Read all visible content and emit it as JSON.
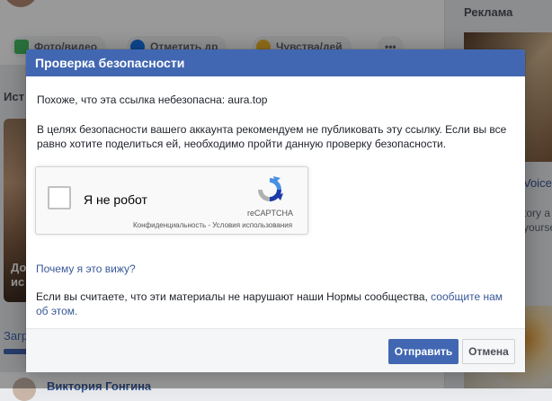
{
  "background": {
    "composer_chips": [
      {
        "label": "Фото/видео",
        "icon": "photo-icon"
      },
      {
        "label": "Отметить др",
        "icon": "tag-friends-icon"
      },
      {
        "label": "Чувства/дей",
        "icon": "feeling-icon"
      },
      {
        "label": "•••",
        "icon": "more-icon"
      }
    ],
    "stories_title": "Ист",
    "story_text_line1": "До",
    "story_text_line2": "ис",
    "load_link": "Загр",
    "author_name": "Виктория Гонгина",
    "ads_title": "Реклама",
    "ad_voice": "Voice",
    "ad_text_line1": "tory a",
    "ad_text_line2": "yourse"
  },
  "dialog": {
    "title": "Проверка безопасности",
    "unsafe_text": "Похоже, что эта ссылка небезопасна: aura.top",
    "advice_text": "В целях безопасности вашего аккаунта рекомендуем не публиковать эту ссылку. Если вы все равно хотите поделиться ей, необходимо пройти данную проверку безопасности.",
    "recaptcha": {
      "checkbox_label": "Я не робот",
      "brand": "reCAPTCHA",
      "links": "Конфиденциальность - Условия использования"
    },
    "why_link": "Почему я это вижу?",
    "report_text": "Если вы считаете, что эти материалы не нарушают наши Нормы сообщества, ",
    "report_link": "сообщите нам об этом.",
    "buttons": {
      "submit": "Отправить",
      "cancel": "Отмена"
    }
  },
  "colors": {
    "header": "#4267b2",
    "link": "#385898",
    "primary_button": "#4267b2"
  }
}
